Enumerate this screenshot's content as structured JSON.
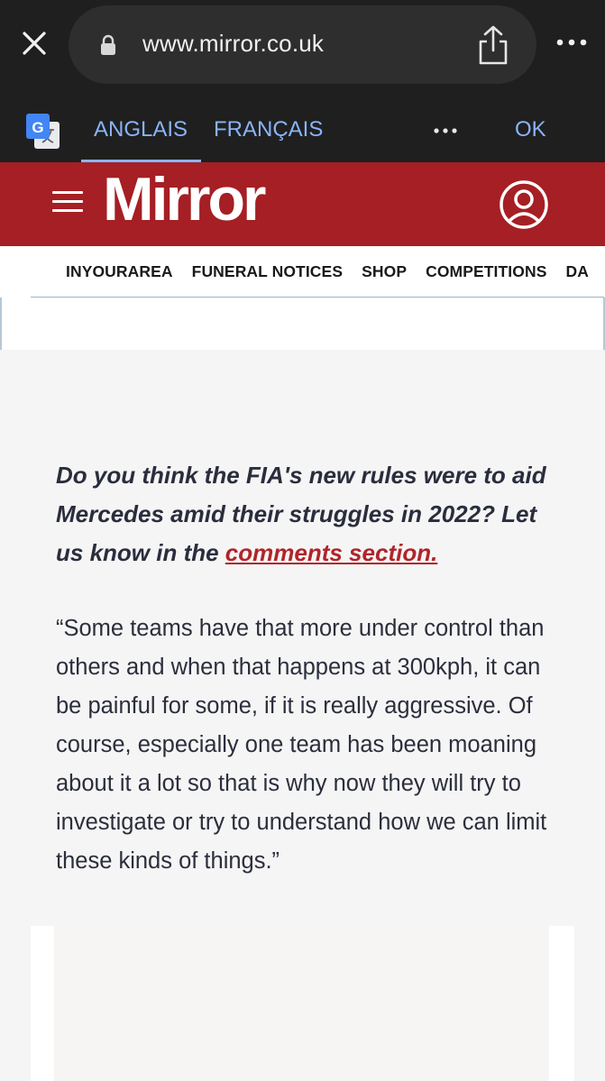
{
  "browser": {
    "url": "www.mirror.co.uk",
    "icons": [
      "close-icon",
      "lock-icon",
      "share-icon",
      "more-vertical-icon"
    ]
  },
  "translate": {
    "source_lang": "ANGLAIS",
    "target_lang": "FRANÇAIS",
    "ok_label": "OK",
    "icons": [
      "google-translate-icon",
      "more-horizontal-icon"
    ]
  },
  "header": {
    "logo": "Mirror",
    "icons": [
      "hamburger-menu-icon",
      "user-account-icon"
    ]
  },
  "nav": {
    "items": [
      "INYOURAREA",
      "FUNERAL NOTICES",
      "SHOP",
      "COMPETITIONS",
      "DA"
    ]
  },
  "article": {
    "prompt_text": "Do you think the FIA's new rules were to aid Mercedes amid their struggles in 2022? Let us know in the ",
    "prompt_link": "comments section.",
    "quote": "“Some teams have that more under control than others and when that happens at 300kph, it can be painful for some, if it is really aggressive. Of course, especially one team has been moaning about it a lot so that is why now they will try to investigate or try to understand how we can limit these kinds of things.”"
  },
  "colors": {
    "brand_red": "#a51f24",
    "link_red": "#b0252a",
    "translate_blue": "#8ab4f8",
    "browser_dark": "#1f1f1f"
  }
}
